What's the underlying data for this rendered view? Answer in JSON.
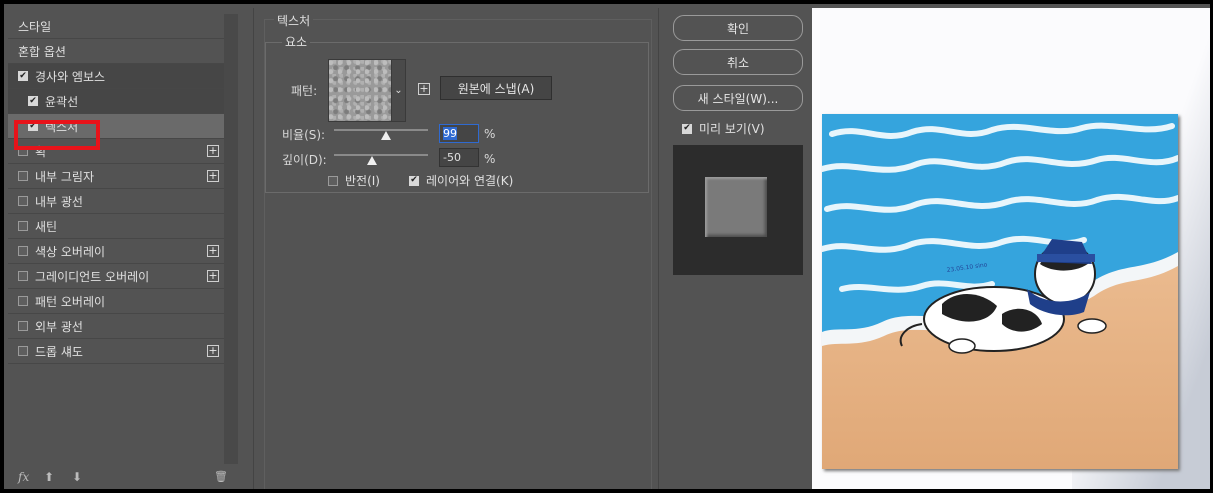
{
  "styles_panel": {
    "items": [
      {
        "label": "스타일",
        "checkbox": false,
        "checked": false,
        "plus": false
      },
      {
        "label": "혼합 옵션",
        "checkbox": false,
        "checked": false,
        "plus": false
      },
      {
        "label": "경사와 엠보스",
        "checkbox": true,
        "checked": true,
        "plus": false
      },
      {
        "label": "윤곽선",
        "checkbox": true,
        "checked": true,
        "plus": false
      },
      {
        "label": "텍스처",
        "checkbox": true,
        "checked": true,
        "plus": false
      },
      {
        "label": "획",
        "checkbox": true,
        "checked": false,
        "plus": true
      },
      {
        "label": "내부 그림자",
        "checkbox": true,
        "checked": false,
        "plus": true
      },
      {
        "label": "내부 광선",
        "checkbox": true,
        "checked": false,
        "plus": false
      },
      {
        "label": "새틴",
        "checkbox": true,
        "checked": false,
        "plus": false
      },
      {
        "label": "색상 오버레이",
        "checkbox": true,
        "checked": false,
        "plus": true
      },
      {
        "label": "그레이디언트 오버레이",
        "checkbox": true,
        "checked": false,
        "plus": true
      },
      {
        "label": "패턴 오버레이",
        "checkbox": true,
        "checked": false,
        "plus": false
      },
      {
        "label": "외부 광선",
        "checkbox": true,
        "checked": false,
        "plus": false
      },
      {
        "label": "드롭 섀도",
        "checkbox": true,
        "checked": false,
        "plus": true
      }
    ],
    "footer": {
      "fx": "fx",
      "up": "⬆",
      "down": "⬇",
      "trash": "🗑"
    }
  },
  "texture": {
    "section_title": "텍스처",
    "group_title": "요소",
    "pattern_label": "패턴:",
    "dropdown_glyph": "⌄",
    "new_preset_glyph": "+",
    "snap_button": "원본에 스냅(A)",
    "scale_label": "비율(S):",
    "scale_value": "99",
    "scale_unit": "%",
    "scale_level": 0.99,
    "depth_label": "깊이(D):",
    "depth_value": "-50",
    "depth_unit": "%",
    "depth_level": -0.5,
    "invert_label": "반전(I)",
    "invert_checked": false,
    "link_label": "레이어와 연결(K)",
    "link_checked": true
  },
  "actions": {
    "ok": "확인",
    "cancel": "취소",
    "new_style": "새 스타일(W)...",
    "preview_label": "미리 보기(V)",
    "preview_checked": true
  },
  "artwork": {
    "signature": "23.05.10 sino"
  },
  "colors": {
    "panel": "#535353",
    "highlight": "#e8131a",
    "water": "#3aa9df",
    "sand": "#e8b583"
  }
}
